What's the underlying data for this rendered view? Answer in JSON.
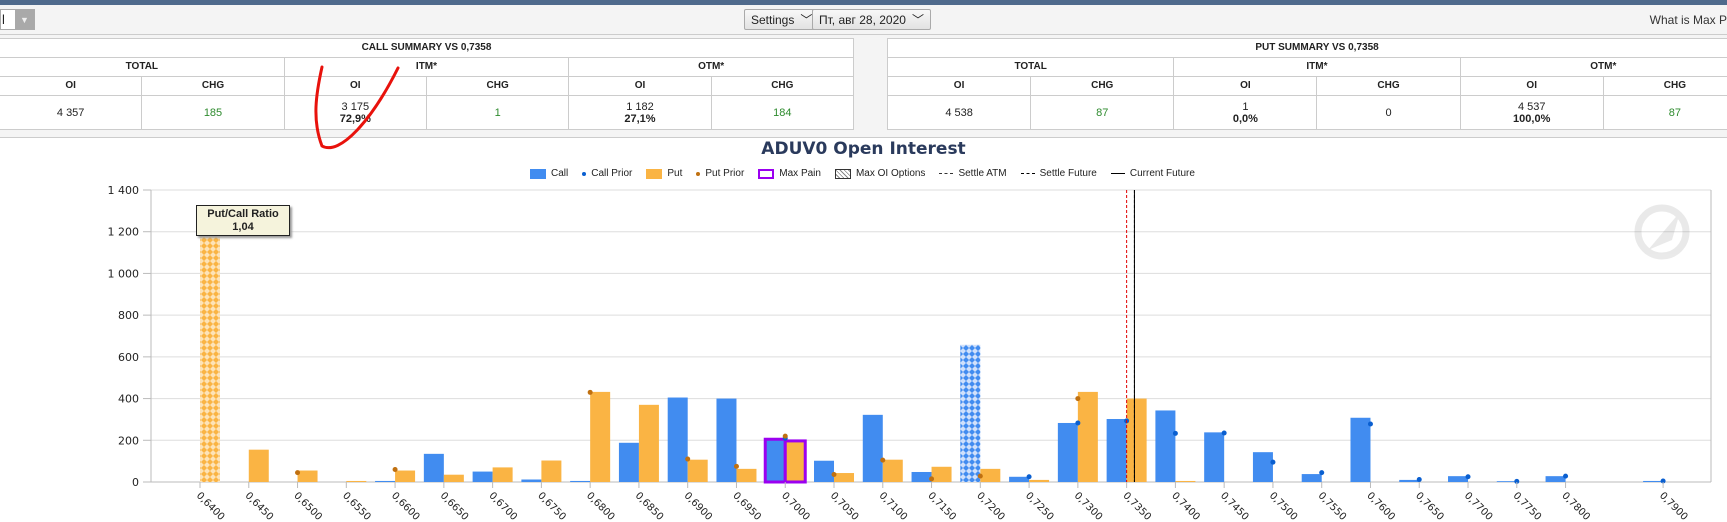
{
  "toolbar": {
    "left_select_value": "l",
    "settings_label": "Settings",
    "date_label": "Пт, авг 28, 2020",
    "help_link": "What is Max P"
  },
  "call_summary": {
    "title": "CALL SUMMARY VS 0,7358",
    "groups": [
      "TOTAL",
      "ITM*",
      "OTM*"
    ],
    "headers": [
      "OI",
      "CHG",
      "OI",
      "CHG",
      "OI",
      "CHG"
    ],
    "total_oi": "4 357",
    "total_chg": "185",
    "itm_oi": "3 175",
    "itm_pct": "72,9%",
    "itm_chg": "1",
    "otm_oi": "1 182",
    "otm_pct": "27,1%",
    "otm_chg": "184"
  },
  "put_summary": {
    "title": "PUT SUMMARY VS 0,7358",
    "groups": [
      "TOTAL",
      "ITM*",
      "OTM*"
    ],
    "headers": [
      "OI",
      "CHG",
      "OI",
      "CHG",
      "OI",
      "CHG"
    ],
    "total_oi": "4 538",
    "total_chg": "87",
    "itm_oi": "1",
    "itm_pct": "0,0%",
    "itm_chg": "0",
    "otm_oi": "4 537",
    "otm_pct": "100,0%",
    "otm_chg": "87"
  },
  "colors": {
    "call": "#418cf0",
    "put": "#fab444",
    "call_prior": "#0a5fd0",
    "put_prior": "#c07010",
    "max_pain": "#9b00f0",
    "settle_atm": "#e00000",
    "positive_chg": "#2e8b2e"
  },
  "tooltip": {
    "title": "Put/Call Ratio",
    "value": "1,04"
  },
  "chart_data": {
    "type": "bar",
    "title": "ADUV0 Open Interest",
    "legend": [
      "Call",
      "Call Prior",
      "Put",
      "Put Prior",
      "Max Pain",
      "Max OI Options",
      "Settle ATM",
      "Settle Future",
      "Current Future"
    ],
    "legend_placement": "top",
    "ylim": [
      0,
      1400
    ],
    "y_ticks": [
      "0",
      "200",
      "400",
      "600",
      "800",
      "1 000",
      "1 200",
      "1 400"
    ],
    "grid": true,
    "strikes": [
      0.64,
      0.645,
      0.65,
      0.655,
      0.66,
      0.665,
      0.67,
      0.675,
      0.68,
      0.685,
      0.69,
      0.695,
      0.7,
      0.705,
      0.71,
      0.715,
      0.72,
      0.725,
      0.73,
      0.735,
      0.74,
      0.745,
      0.75,
      0.755,
      0.76,
      0.765,
      0.77,
      0.775,
      0.78,
      0.79
    ],
    "categories": [
      "0,6400",
      "0,6450",
      "0,6500",
      "0,6550",
      "0,6600",
      "0,6650",
      "0,6700",
      "0,6750",
      "0,6800",
      "0,6850",
      "0,6900",
      "0,6950",
      "0,7000",
      "0,7050",
      "0,7100",
      "0,7150",
      "0,7200",
      "0,7250",
      "0,7300",
      "0,7350",
      "0,7400",
      "0,7450",
      "0,7500",
      "0,7550",
      "0,7600",
      "0,7650",
      "0,7700",
      "0,7750",
      "0,7800",
      "0,7900"
    ],
    "series": [
      {
        "name": "Call",
        "values": [
          0,
          0,
          0,
          0,
          5,
          135,
          50,
          12,
          5,
          188,
          405,
          400,
          205,
          102,
          322,
          48,
          658,
          25,
          283,
          302,
          343,
          238,
          143,
          38,
          308,
          10,
          28,
          4,
          28,
          5
        ]
      },
      {
        "name": "Call Prior",
        "values": [
          null,
          null,
          null,
          null,
          null,
          null,
          null,
          null,
          null,
          null,
          null,
          null,
          210,
          null,
          null,
          null,
          null,
          25,
          283,
          293,
          233,
          235,
          95,
          45,
          278,
          12,
          25,
          3,
          28,
          5
        ]
      },
      {
        "name": "Put",
        "values": [
          1310,
          155,
          55,
          5,
          55,
          35,
          70,
          103,
          432,
          370,
          107,
          63,
          197,
          43,
          107,
          73,
          63,
          10,
          432,
          400,
          5,
          0,
          0,
          0,
          0,
          0,
          0,
          0,
          0,
          0
        ]
      },
      {
        "name": "Put Prior",
        "values": [
          1310,
          null,
          45,
          null,
          60,
          null,
          null,
          null,
          430,
          null,
          110,
          75,
          220,
          36,
          105,
          15,
          28,
          null,
          400,
          null,
          null,
          null,
          null,
          null,
          null,
          null,
          null,
          null,
          null,
          null
        ]
      }
    ],
    "max_pain": "0,7000",
    "max_oi_call": "0,7200",
    "max_oi_put": "0,6400",
    "settle_atm": 0.735,
    "settle_future": 0.7358,
    "current_future": 0.7358
  }
}
